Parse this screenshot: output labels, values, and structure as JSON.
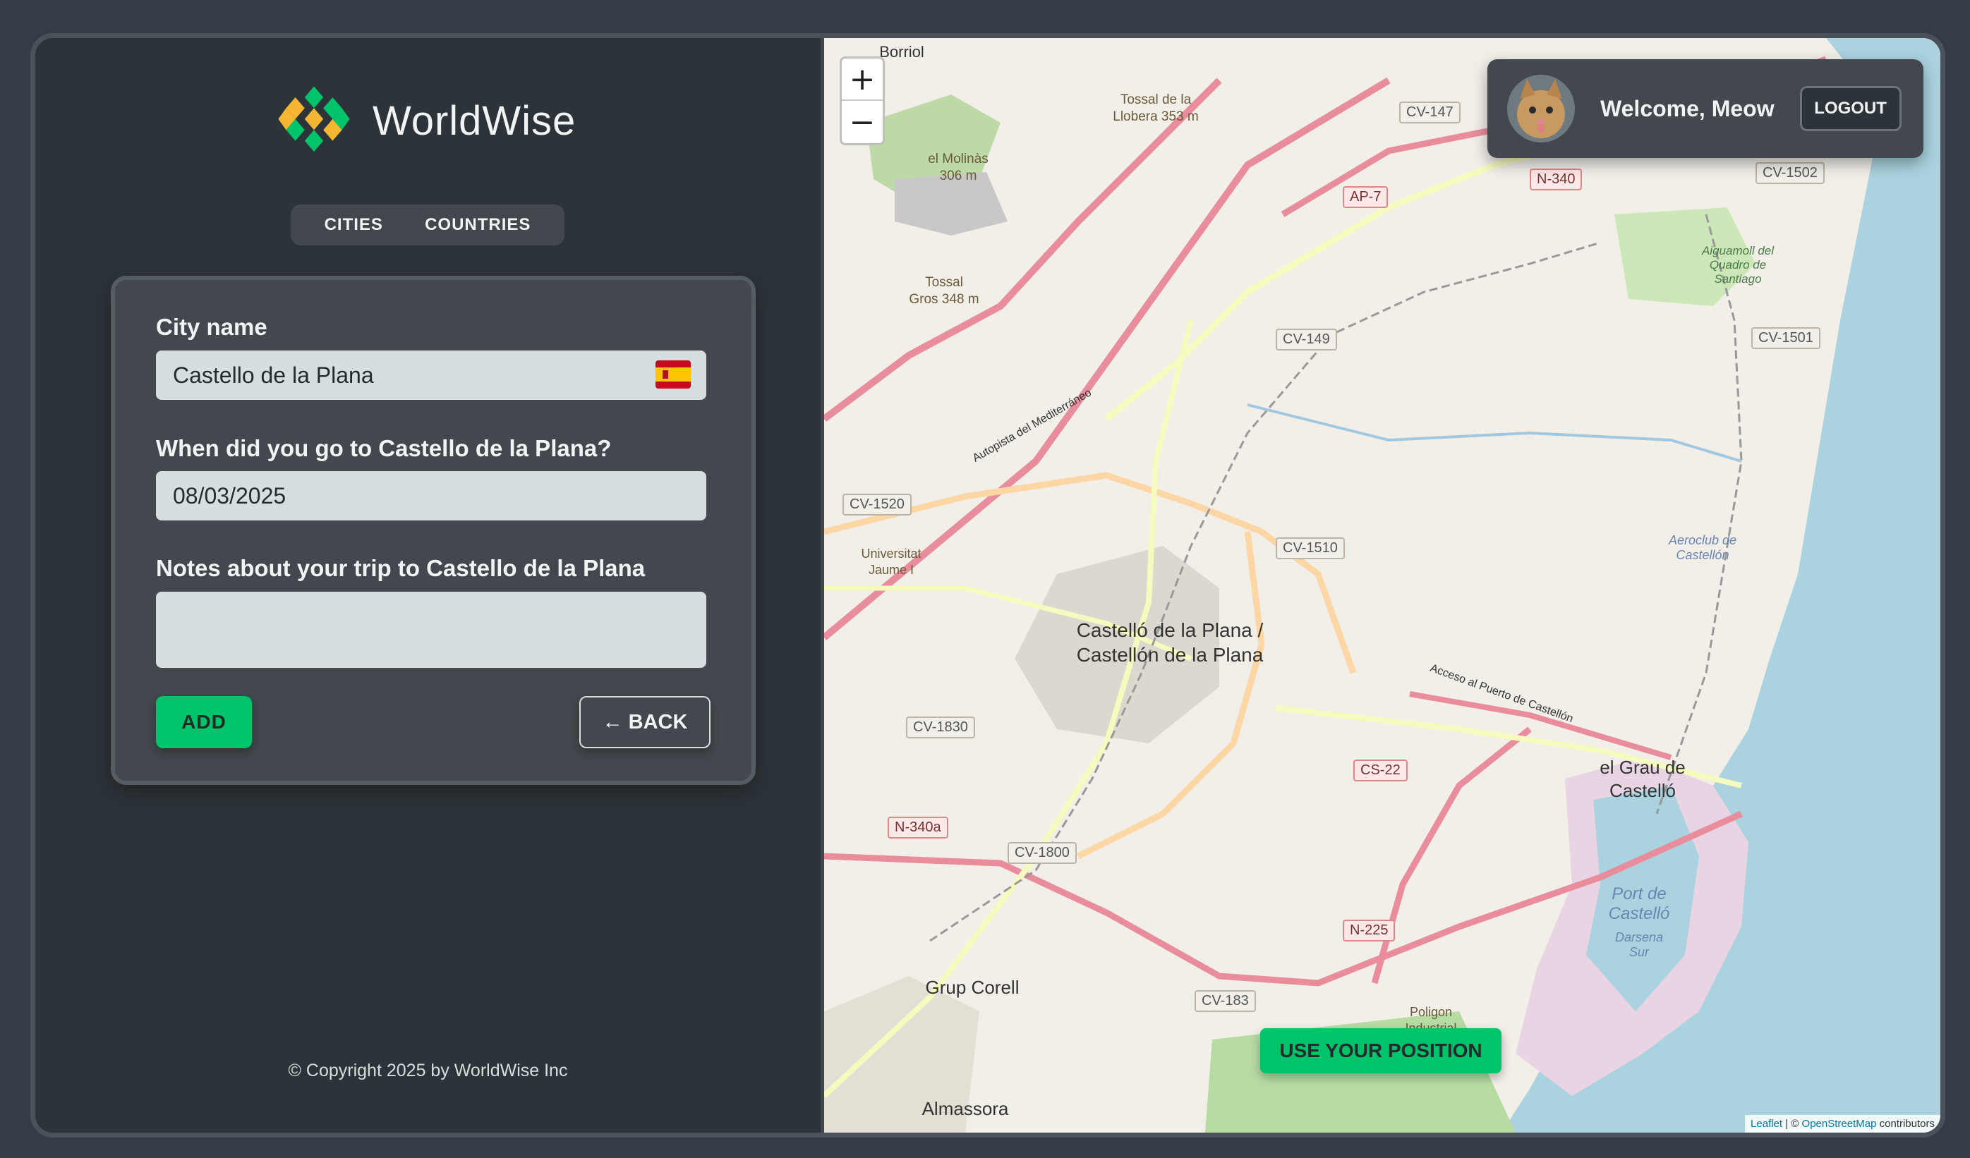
{
  "app": {
    "name": "WorldWise"
  },
  "nav": {
    "cities": "Cities",
    "countries": "Countries"
  },
  "form": {
    "city_label": "City name",
    "city_value": "Castello de la Plana",
    "date_label": "When did you go to Castello de la Plana?",
    "date_value": "08/03/2025",
    "notes_label": "Notes about your trip to Castello de la Plana",
    "notes_value": "",
    "add_label": "ADD",
    "back_label": "← BACK"
  },
  "footer": {
    "copyright": "© Copyright 2025 by WorldWise Inc"
  },
  "user": {
    "welcome": "Welcome, Meow",
    "logout": "LOGOUT"
  },
  "map": {
    "zoom_in": "+",
    "zoom_out": "−",
    "position_button": "USE YOUR POSITION",
    "attribution_leaflet": "Leaflet",
    "attribution_osm": "OpenStreetMap",
    "attribution_suffix": "contributors",
    "labels": {
      "city": "Castelló de la Plana / Castellón de la Plana",
      "grau": "el Grau de Castelló",
      "port": "Port de Castelló",
      "darsena": "Darsena Sur",
      "grup": "Grup Corell",
      "almassora": "Almassora",
      "borriol": "Borriol",
      "molinas": "el Molinàs 306 m",
      "llobera": "Tossal de la Llobera 353 m",
      "tossal_gros": "Tossal Gros 348 m",
      "aeroclub": "Aeroclub de Castellón",
      "aiguamoll": "Aiguamoll del Quadro de Santiago",
      "universitat": "Universitat Jaume I",
      "poligon": "Poligon Industrial",
      "autopista": "Autopista del Mediterráneo",
      "acceso_puerto": "Acceso al Puerto de Castellón"
    },
    "shields": [
      "CV-147",
      "AP-7",
      "N-340",
      "CV-1502",
      "CV-149",
      "CV-1501",
      "CV-1520",
      "CV-1510",
      "CV-1830",
      "CS-22",
      "N-340a",
      "CV-1800",
      "N-225",
      "CV-183"
    ]
  },
  "colors": {
    "accent": "#00c46a",
    "panel": "#42484d",
    "background": "#2d3439"
  },
  "icons": {
    "zoom_in": "plus-icon",
    "zoom_out": "minus-icon",
    "flag": "spain-flag-icon",
    "logo": "worldwise-logo-icon"
  }
}
